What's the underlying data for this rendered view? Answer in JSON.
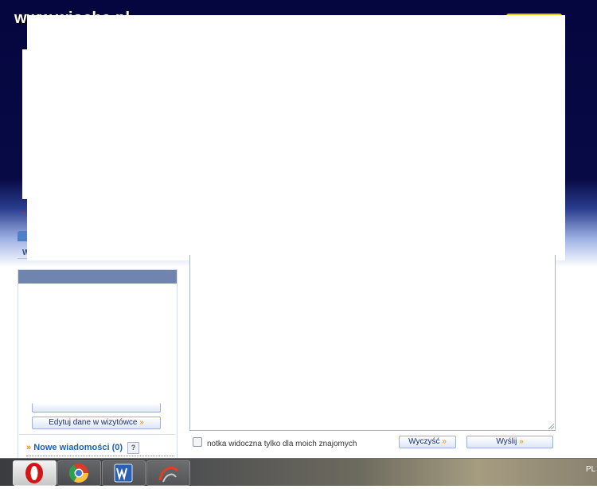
{
  "watermark": {
    "text": "www.wiocha.pl"
  },
  "sidebar": {
    "edge_label": "W",
    "buttons": [
      {
        "label": "Edytuj dane w wizytówce",
        "arrow": "»"
      }
    ],
    "messages": {
      "arrow": "»",
      "label": "Nowe wiadomości (0)",
      "help": "?"
    }
  },
  "composer": {
    "checkbox_label": "notka widoczna tylko dla moich znajomych",
    "clear_label": "Wyczyść",
    "send_label": "Wyślij",
    "arrow": "»",
    "arrow_marker": "»"
  },
  "taskbar": {
    "apps": [
      {
        "icon": "opera-icon",
        "active": true
      },
      {
        "icon": "chrome-icon",
        "active": false
      },
      {
        "icon": "word-icon",
        "active": false
      },
      {
        "icon": "app-swirl-icon",
        "active": false
      }
    ],
    "tray_language": "PL"
  },
  "colors": {
    "header_bg": "#050640",
    "accent_orange": "#f08a00",
    "link_blue": "#1d5fb8"
  }
}
